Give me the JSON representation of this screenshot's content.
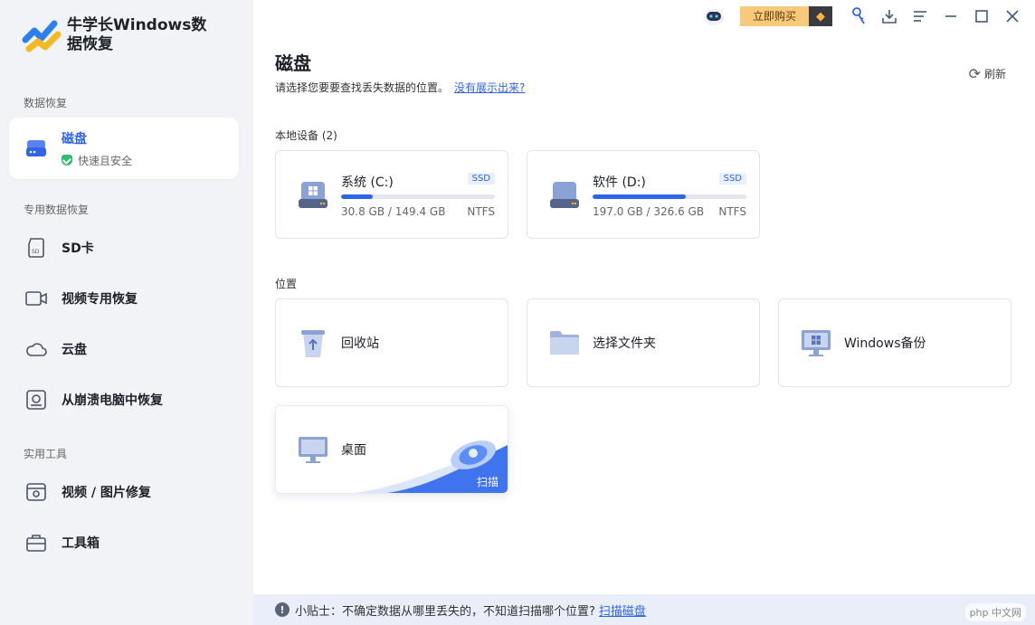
{
  "app": {
    "name": "牛学长Windows数据恢复"
  },
  "sidebar": {
    "sections": {
      "data_recovery": "数据恢复",
      "special_recovery": "专用数据恢复",
      "tools": "实用工具"
    },
    "active_item": {
      "label": "磁盘",
      "subtitle": "快速且安全"
    },
    "items": [
      {
        "label": "SD卡"
      },
      {
        "label": "视频专用恢复"
      },
      {
        "label": "云盘"
      },
      {
        "label": "从崩溃电脑中恢复"
      },
      {
        "label": "视频 / 图片修复"
      },
      {
        "label": "工具箱"
      }
    ]
  },
  "topbar": {
    "buy_label": "立即购买"
  },
  "main": {
    "title": "磁盘",
    "description": "请选择您要要查找丢失数据的位置。",
    "help_link": "没有展示出来?",
    "refresh_label": "刷新",
    "local_devices_label": "本地设备 (2)",
    "locations_label": "位置",
    "drives": [
      {
        "name": "系统 (C:)",
        "badge": "SSD",
        "size": "30.8 GB / 149.4 GB",
        "fs": "NTFS",
        "usage": 0.206
      },
      {
        "name": "软件 (D:)",
        "badge": "SSD",
        "size": "197.0 GB / 326.6 GB",
        "fs": "NTFS",
        "usage": 0.603
      }
    ],
    "locations": [
      {
        "name": "回收站"
      },
      {
        "name": "选择文件夹"
      },
      {
        "name": "Windows备份"
      },
      {
        "name": "桌面",
        "action": "扫描"
      }
    ]
  },
  "tip": {
    "text": "小贴士：不确定数据从哪里丢失的，不知道扫描哪个位置?",
    "link": "扫描磁盘"
  },
  "watermark": "php 中文网",
  "colors": {
    "accent": "#2f63e8",
    "sidebar_bg": "#f2f3f6",
    "buy_bg": "#f7c97a"
  }
}
